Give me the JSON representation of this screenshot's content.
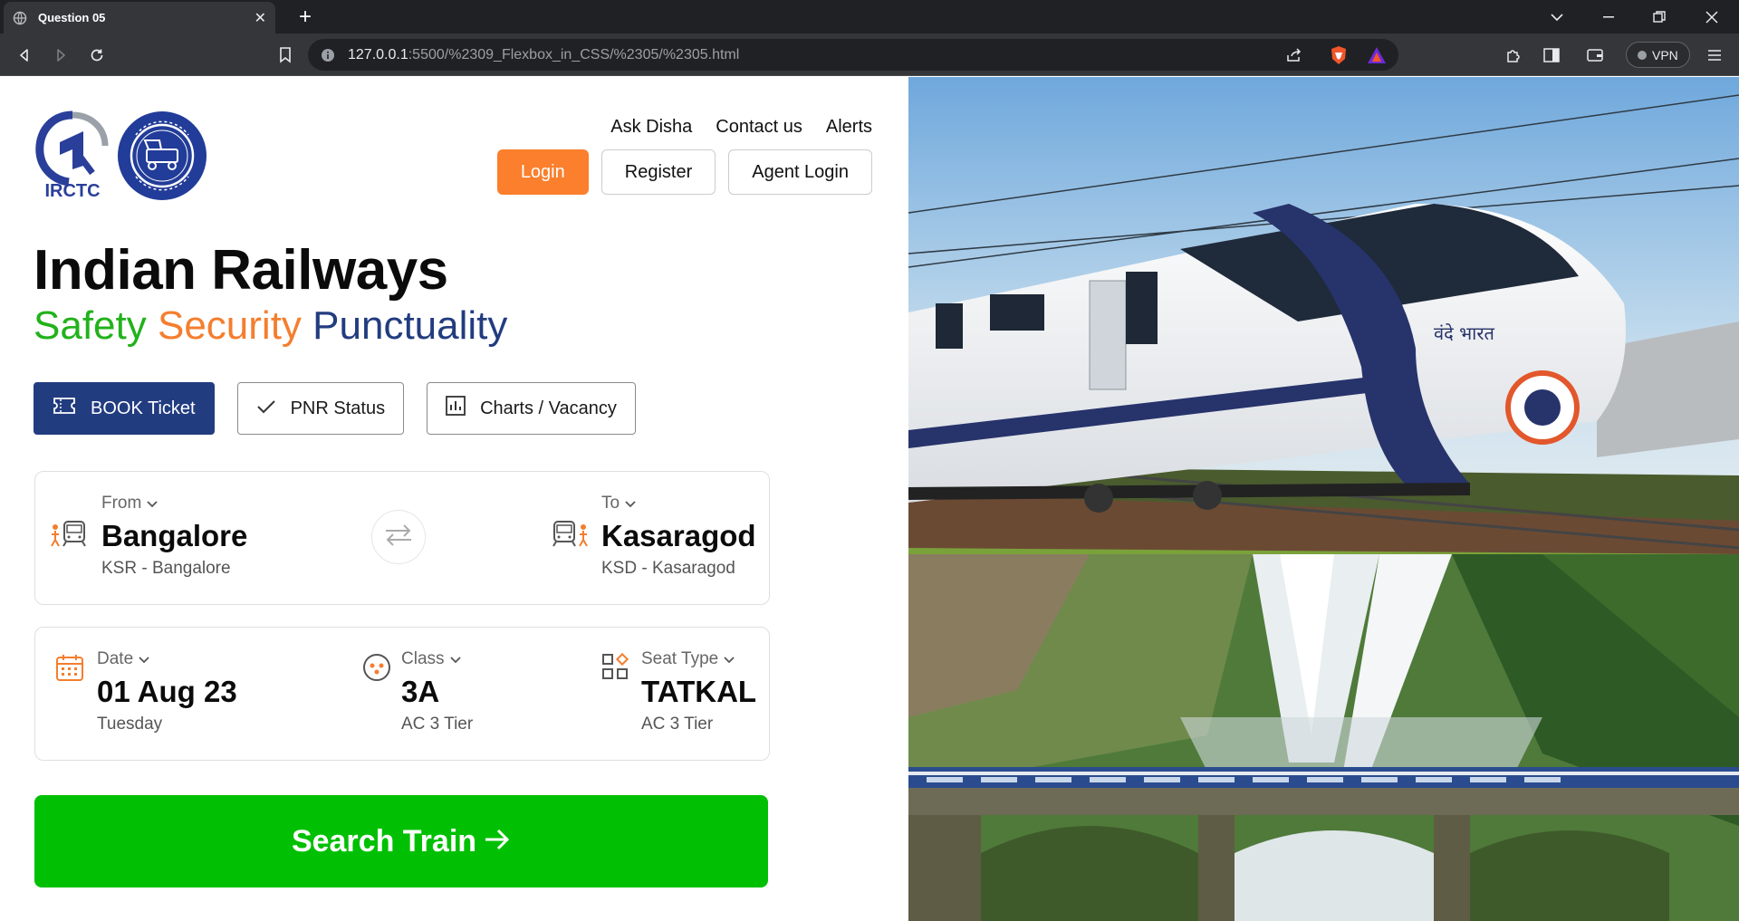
{
  "browser": {
    "tab_title": "Question 05",
    "url_host": "127.0.0.1",
    "url_path": ":5500/%2309_Flexbox_in_CSS/%2305/%2305.html",
    "vpn_label": "VPN"
  },
  "header": {
    "logo_irctc_text": "IRCTC",
    "nav_links": [
      "Ask Disha",
      "Contact us",
      "Alerts"
    ],
    "login_label": "Login",
    "register_label": "Register",
    "agent_login_label": "Agent Login"
  },
  "hero": {
    "title": "Indian Railways",
    "tag_safety": "Safety",
    "tag_security": "Security",
    "tag_punctuality": "Punctuality"
  },
  "modes": {
    "book": "BOOK Ticket",
    "pnr": "PNR Status",
    "charts": "Charts / Vacancy"
  },
  "journey": {
    "from_label": "From",
    "from_city": "Bangalore",
    "from_station": "KSR - Bangalore",
    "to_label": "To",
    "to_city": "Kasaragod",
    "to_station": "KSD - Kasaragod"
  },
  "details": {
    "date_label": "Date",
    "date_value": "01 Aug 23",
    "date_day": "Tuesday",
    "class_label": "Class",
    "class_value": "3A",
    "class_sub": "AC 3 Tier",
    "seat_label": "Seat Type",
    "seat_value": "TATKAL",
    "seat_sub": "AC 3 Tier"
  },
  "search_label": "Search Train",
  "colors": {
    "primary_blue": "#223c80",
    "login_orange": "#fb7f2c",
    "search_green": "#01c003",
    "tag_green": "#22b21b",
    "tag_orange": "#f47e2e"
  },
  "images": {
    "train_image_text": "वंदे भारत"
  }
}
